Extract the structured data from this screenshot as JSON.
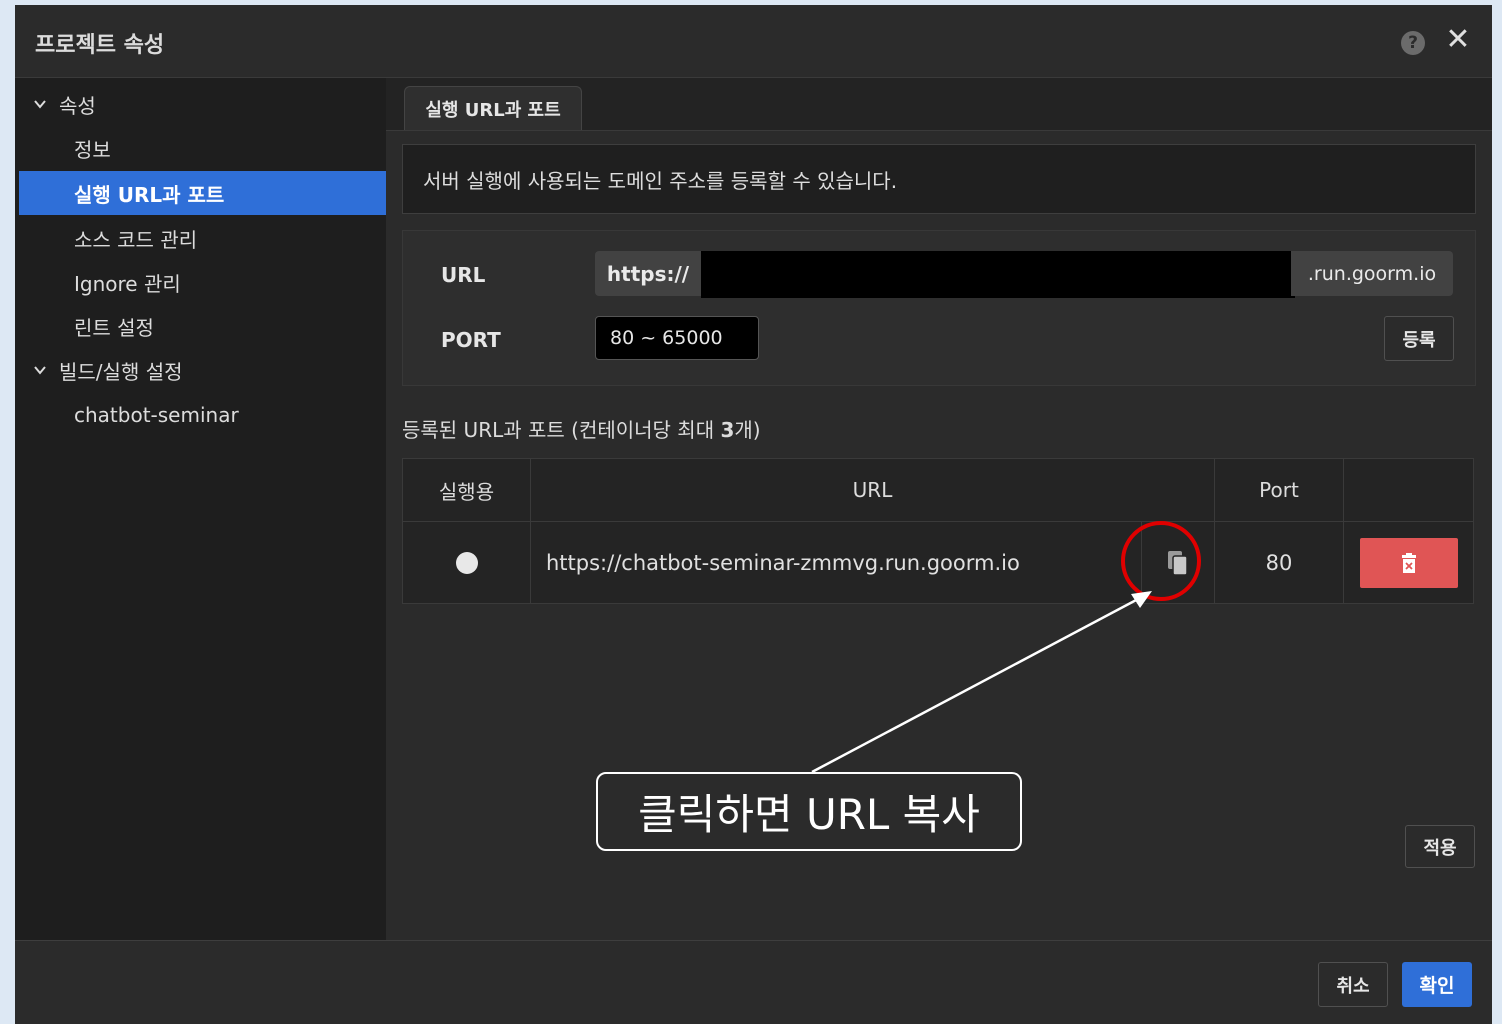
{
  "dialog": {
    "title": "프로젝트 속성",
    "help_icon": "question-circle-icon",
    "close_icon": "close-icon"
  },
  "sidebar": {
    "groups": [
      {
        "label": "속성",
        "items": [
          "정보",
          "실행 URL과 포트",
          "소스 코드 관리",
          "Ignore 관리",
          "린트 설정"
        ]
      },
      {
        "label": "빌드/실행 설정",
        "items": [
          "chatbot-seminar"
        ]
      }
    ],
    "active_item": "실행 URL과 포트"
  },
  "tab": {
    "label": "실행 URL과 포트"
  },
  "info": {
    "text": "서버 실행에 사용되는 도메인 주소를 등록할 수 있습니다."
  },
  "form": {
    "url_label": "URL",
    "url_prefix": "https://",
    "url_value": "",
    "url_suffix": ".run.goorm.io",
    "port_label": "PORT",
    "port_placeholder": "80 ~ 65000",
    "register_button": "등록"
  },
  "registered": {
    "title_pre": "등록된 URL과 포트 (컨테이너당 최대 ",
    "title_num": "3",
    "title_post": "개)",
    "columns": [
      "실행용",
      "URL",
      "Port",
      ""
    ],
    "rows": [
      {
        "url": "https://chatbot-seminar-zmmvg.run.goorm.io",
        "port": "80",
        "selected": true
      }
    ]
  },
  "annotation": {
    "text": "클릭하면 URL 복사",
    "highlight_color": "#e00000"
  },
  "apply_button": "적용",
  "footer": {
    "cancel": "취소",
    "confirm": "확인"
  },
  "colors": {
    "accent": "#2f6fd8",
    "danger": "#e05555"
  }
}
